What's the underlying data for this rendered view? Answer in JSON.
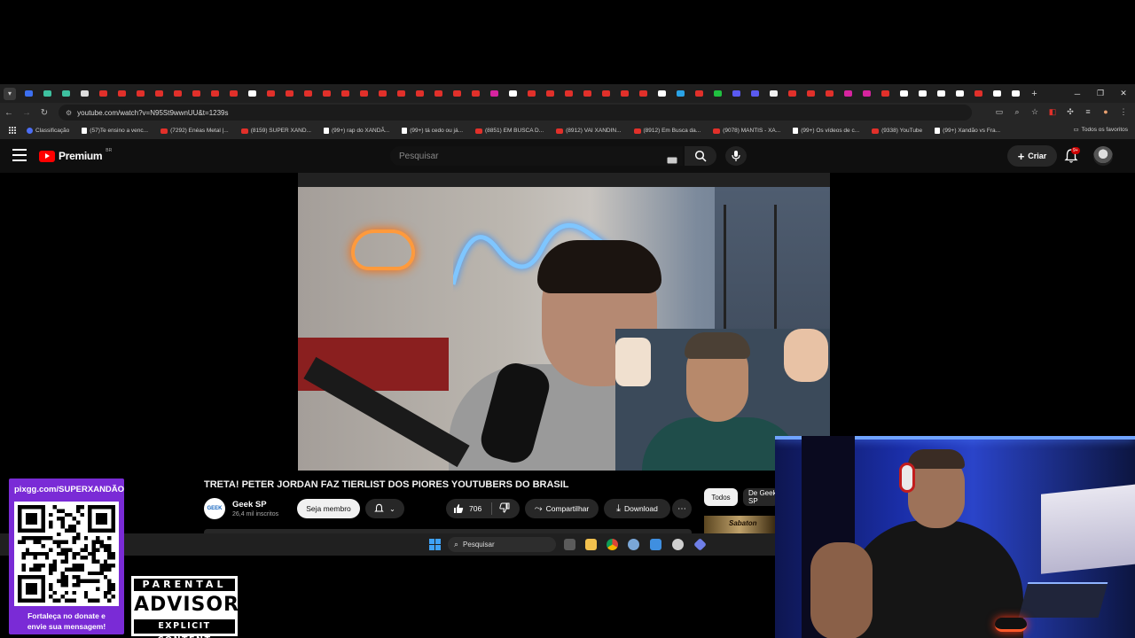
{
  "browser": {
    "url": "youtube.com/watch?v=N95St9wwnUU&t=1239s",
    "bookmarks": [
      {
        "label": "Classificação",
        "icon": "classification-icon"
      },
      {
        "label": "(57)Te ensino a venc...",
        "icon": "tiktok-icon"
      },
      {
        "label": "(7292) Enéas Metal |...",
        "icon": "youtube-icon"
      },
      {
        "label": "(8159) SUPER XAND...",
        "icon": "youtube-icon"
      },
      {
        "label": "(99+) rap do XANDÃ...",
        "icon": "tiktok-icon"
      },
      {
        "label": "(99+) tá cedo ou já...",
        "icon": "tiktok-icon"
      },
      {
        "label": "(8851) EM BUSCA D...",
        "icon": "youtube-icon"
      },
      {
        "label": "(8912) VAI XANDIN...",
        "icon": "youtube-icon"
      },
      {
        "label": "(8912) Em Busca da...",
        "icon": "youtube-icon"
      },
      {
        "label": "(9078) MANTIS - XA...",
        "icon": "youtube-icon"
      },
      {
        "label": "(99+) Os vídeos de c...",
        "icon": "tiktok-icon"
      },
      {
        "label": "(9338) YouTube",
        "icon": "youtube-icon"
      },
      {
        "label": "(99+) Xandão vs Fra...",
        "icon": "tiktok-icon"
      }
    ],
    "all_bookmarks_label": "Todos os favoritos",
    "tab_favicon_colors": [
      "#3c6ff0",
      "#3ec1a0",
      "#3ec1a0",
      "#dddddd",
      "#e1302a",
      "#e1302a",
      "#e1302a",
      "#e1302a",
      "#e1302a",
      "#e1302a",
      "#e1302a",
      "#e1302a",
      "#ffffff",
      "#e1302a",
      "#e1302a",
      "#e1302a",
      "#e1302a",
      "#e1302a",
      "#e1302a",
      "#e1302a",
      "#e1302a",
      "#e1302a",
      "#e1302a",
      "#e1302a",
      "#e1302a",
      "#d6249f",
      "#ffffff",
      "#e1302a",
      "#e1302a",
      "#e1302a",
      "#e1302a",
      "#e1302a",
      "#e1302a",
      "#e1302a",
      "#ffffff",
      "#2aa3e6",
      "#e1302a",
      "#20c040",
      "#5a5af0",
      "#5a5af0",
      "#f0f0f0",
      "#e1302a",
      "#e1302a",
      "#e1302a",
      "#d6249f",
      "#d6249f",
      "#e1302a",
      "#ffffff",
      "#ffffff",
      "#ffffff",
      "#ffffff",
      "#e1302a",
      "#ffffff",
      "#ffffff"
    ]
  },
  "youtube": {
    "logo_text": "Premium",
    "region": "BR",
    "search_placeholder": "Pesquisar",
    "create_label": "Criar",
    "notifications_badge": "9+",
    "video_title": "TRETA! PETER JORDAN FAZ TIERLIST DOS PIORES YOUTUBERS DO BRASIL",
    "channel_name": "Geek SP",
    "channel_subs": "26,4 mil inscritos",
    "channel_avatar_text": "GEEK",
    "member_label": "Seja membro",
    "likes": "706",
    "share_label": "Compartilhar",
    "download_label": "Download",
    "chips": [
      "Todos",
      "De Geek SP"
    ],
    "related_thumb_text": "Sabaton"
  },
  "taskbar": {
    "search_placeholder": "Pesquisar"
  },
  "overlays": {
    "donate_url": "pixgg.com/SUPERXANDÃO",
    "donate_message_line1": "Fortaleça no donate e",
    "donate_message_line2": "envie sua mensagem!",
    "advisory_top": "PARENTAL",
    "advisory_mid": "ADVISORY",
    "advisory_bottom": "EXPLICIT CONTENT"
  },
  "colors": {
    "youtube_red": "#ff0000",
    "donate_purple": "#7a2bd6",
    "chrome_dark": "#1f1f1f"
  }
}
